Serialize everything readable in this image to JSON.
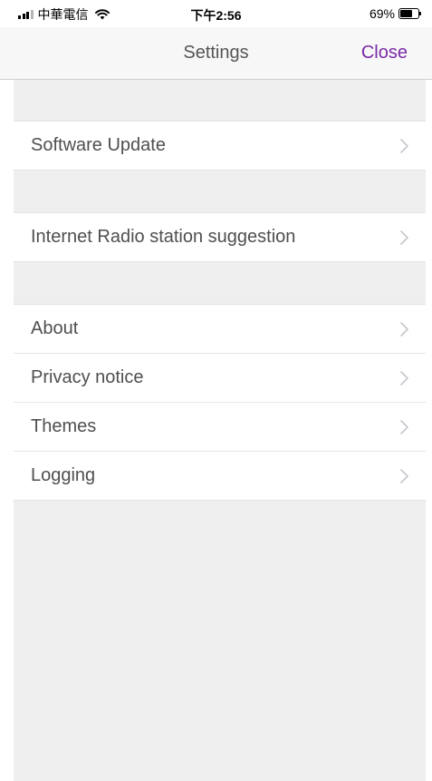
{
  "status_bar": {
    "carrier": "中華電信",
    "time": "下午2:56",
    "battery_percent_text": "69%",
    "battery_level": 0.69
  },
  "nav": {
    "title": "Settings",
    "close_label": "Close"
  },
  "groups": [
    {
      "items": [
        {
          "label": "Software Update"
        }
      ]
    },
    {
      "items": [
        {
          "label": "Internet Radio station suggestion"
        }
      ]
    },
    {
      "items": [
        {
          "label": "About"
        },
        {
          "label": "Privacy notice"
        },
        {
          "label": "Themes"
        },
        {
          "label": "Logging"
        }
      ]
    }
  ],
  "colors": {
    "accent": "#7b2aa8",
    "background": "#efefef",
    "row_background": "#ffffff",
    "text": "#4f4f4f",
    "chevron": "#c7c7cc"
  },
  "icons": {
    "signal": "signal-bars-icon",
    "wifi": "wifi-icon",
    "battery": "battery-icon",
    "chevron": "chevron-right-icon"
  }
}
